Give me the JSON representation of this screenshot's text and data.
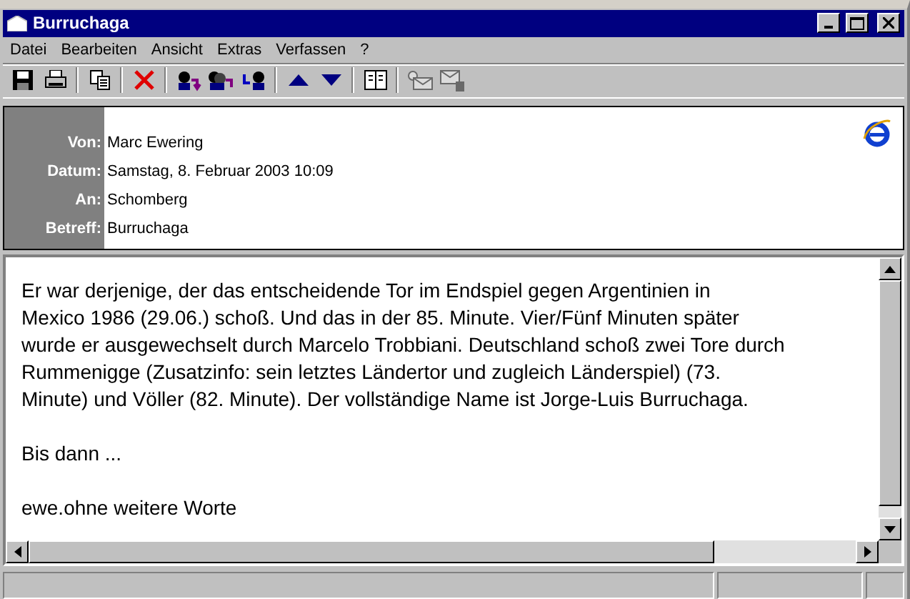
{
  "window": {
    "title": "Burruchaga"
  },
  "menu": [
    "Datei",
    "Bearbeiten",
    "Ansicht",
    "Extras",
    "Verfassen",
    "?"
  ],
  "toolbar": [
    {
      "kind": "save",
      "disabled": false
    },
    {
      "kind": "print",
      "disabled": false
    },
    {
      "kind": "sep"
    },
    {
      "kind": "copy",
      "disabled": false
    },
    {
      "kind": "sep"
    },
    {
      "kind": "delete",
      "disabled": false
    },
    {
      "kind": "sep"
    },
    {
      "kind": "reply",
      "disabled": false
    },
    {
      "kind": "replyall",
      "disabled": false
    },
    {
      "kind": "forward",
      "disabled": false
    },
    {
      "kind": "sep"
    },
    {
      "kind": "up",
      "disabled": false
    },
    {
      "kind": "down",
      "disabled": false
    },
    {
      "kind": "sep"
    },
    {
      "kind": "book",
      "disabled": false
    },
    {
      "kind": "sep"
    },
    {
      "kind": "sign",
      "disabled": true
    },
    {
      "kind": "encrypt",
      "disabled": true
    }
  ],
  "header": [
    {
      "label": "Von:",
      "value": "Marc Ewering"
    },
    {
      "label": "Datum:",
      "value": "Samstag, 8. Februar 2003 10:09"
    },
    {
      "label": "An:",
      "value": "Schomberg"
    },
    {
      "label": "Betreff:",
      "value": "Burruchaga"
    }
  ],
  "body": [
    "Er war derjenige, der das entscheidende Tor im Endspiel gegen Argentinien in\nMexico 1986 (29.06.) schoß. Und das in der 85. Minute. Vier/Fünf Minuten später\nwurde er ausgewechselt durch Marcelo Trobbiani. Deutschland schoß zwei Tore durch\nRummenigge (Zusatzinfo: sein letztes Ländertor und zugleich Länderspiel) (73.\nMinute) und Völler (82. Minute). Der vollständige Name ist Jorge-Luis Burruchaga.",
    "Bis dann ...",
    "ewe.ohne weitere Worte"
  ]
}
